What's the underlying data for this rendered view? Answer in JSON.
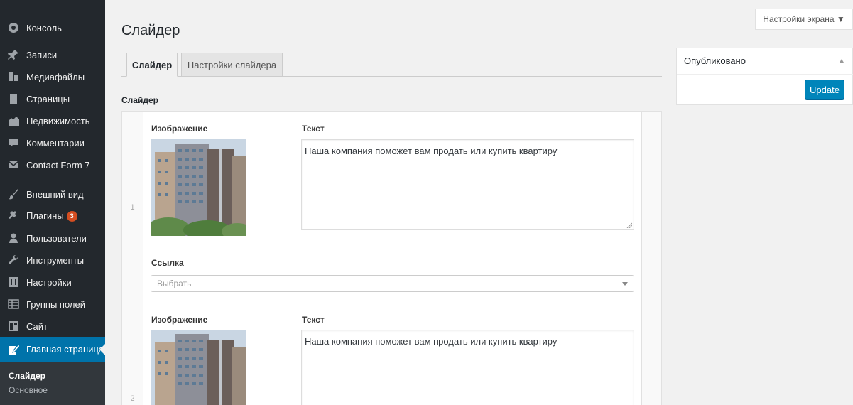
{
  "sidebar": {
    "items": [
      {
        "label": "Консоль",
        "icon": "dashboard-icon"
      },
      {
        "label": "Записи",
        "icon": "pin-icon"
      },
      {
        "label": "Медиафайлы",
        "icon": "media-icon"
      },
      {
        "label": "Страницы",
        "icon": "page-icon"
      },
      {
        "label": "Недвижимость",
        "icon": "buildings-icon"
      },
      {
        "label": "Комментарии",
        "icon": "comment-icon"
      },
      {
        "label": "Contact Form 7",
        "icon": "mail-icon"
      },
      {
        "label": "Внешний вид",
        "icon": "brush-icon"
      },
      {
        "label": "Плагины",
        "icon": "plugin-icon",
        "badge": "3"
      },
      {
        "label": "Пользователи",
        "icon": "user-icon"
      },
      {
        "label": "Инструменты",
        "icon": "wrench-icon"
      },
      {
        "label": "Настройки",
        "icon": "settings-icon"
      },
      {
        "label": "Группы полей",
        "icon": "table-icon"
      },
      {
        "label": "Сайт",
        "icon": "site-icon"
      },
      {
        "label": "Главная страница",
        "icon": "edit-icon"
      }
    ],
    "submenu": [
      {
        "label": "Слайдер"
      },
      {
        "label": "Основное"
      }
    ]
  },
  "screen_options": "Настройки экрана ▼",
  "page_title": "Слайдер",
  "tabs": [
    {
      "label": "Слайдер"
    },
    {
      "label": "Настройки слайдера"
    }
  ],
  "field_label": "Слайдер",
  "rows": [
    {
      "index": "1",
      "image_label": "Изображение",
      "text_label": "Текст",
      "text_value": "Наша компания поможет вам продать или купить квартиру",
      "link_label": "Ссылка",
      "link_placeholder": "Выбрать"
    },
    {
      "index": "2",
      "image_label": "Изображение",
      "text_label": "Текст",
      "text_value": "Наша компания поможет вам продать или купить квартиру"
    }
  ],
  "publish": {
    "title": "Опубликовано",
    "update_label": "Update"
  },
  "colors": {
    "sidebar_bg": "#23282d",
    "active_menu": "#0073aa",
    "primary_button": "#0085ba",
    "badge": "#d54e21"
  }
}
